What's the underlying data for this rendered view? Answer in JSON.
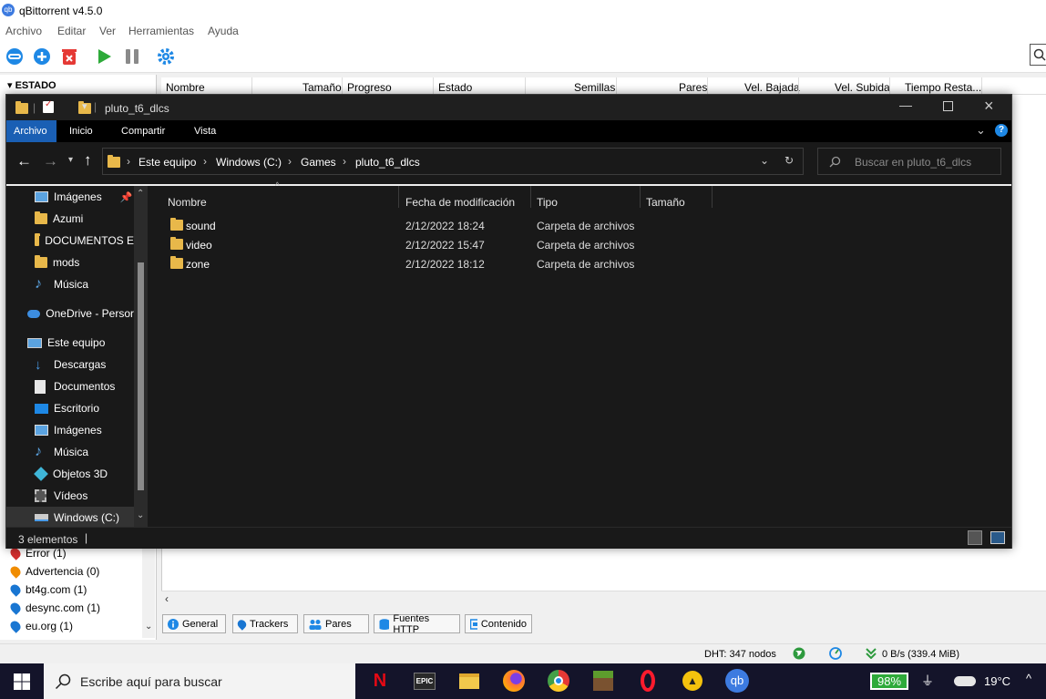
{
  "qbt": {
    "title": "qBittorrent v4.5.0",
    "icon_text": "qb",
    "menu": [
      "Archivo",
      "Editar",
      "Ver",
      "Herramientas",
      "Ayuda"
    ],
    "toolbar_icons": [
      "link-icon",
      "add-icon",
      "delete-icon",
      "play-icon",
      "pause-icon",
      "gear-icon"
    ],
    "estado_header": "ESTADO",
    "columns": [
      "Nombre",
      "Tamaño",
      "Progreso",
      "Estado",
      "Semillas",
      "Pares",
      "Vel. Bajada",
      "Vel. Subida",
      "Tiempo Resta..."
    ],
    "trackers": [
      {
        "label": "Error (1)",
        "color": "#d32f2f"
      },
      {
        "label": "Advertencia (0)",
        "color": "#f08c00"
      },
      {
        "label": "bt4g.com (1)",
        "color": "#1976d2"
      },
      {
        "label": "desync.com (1)",
        "color": "#1976d2"
      },
      {
        "label": "eu.org (1)",
        "color": "#1976d2"
      }
    ],
    "prop_tabs": [
      "General",
      "Trackers",
      "Pares",
      "Fuentes HTTP",
      "Contenido"
    ],
    "status": {
      "dht": "DHT: 347 nodos",
      "speed": "0 B/s (339.4 MiB)"
    }
  },
  "explorer": {
    "title": "pluto_t6_dlcs",
    "ribbon_tabs": [
      "Archivo",
      "Inicio",
      "Compartir",
      "Vista"
    ],
    "breadcrumb": [
      "Este equipo",
      "Windows (C:)",
      "Games",
      "pluto_t6_dlcs"
    ],
    "search_placeholder": "Buscar en pluto_t6_dlcs",
    "nav": [
      {
        "label": "Imágenes",
        "icon": "pictures-icon",
        "indent": 1
      },
      {
        "label": "Azumi",
        "icon": "folder-icon",
        "indent": 1
      },
      {
        "label": "DOCUMENTOS E",
        "icon": "folder-icon",
        "indent": 1
      },
      {
        "label": "mods",
        "icon": "folder-icon",
        "indent": 1
      },
      {
        "label": "Música",
        "icon": "music-icon",
        "indent": 1
      },
      {
        "label": "OneDrive - Persor",
        "icon": "cloud-icon",
        "indent": 0
      },
      {
        "label": "Este equipo",
        "icon": "computer-icon",
        "indent": 0
      },
      {
        "label": "Descargas",
        "icon": "download-icon",
        "indent": 1
      },
      {
        "label": "Documentos",
        "icon": "documents-icon",
        "indent": 1
      },
      {
        "label": "Escritorio",
        "icon": "desktop-icon",
        "indent": 1
      },
      {
        "label": "Imágenes",
        "icon": "pictures-icon",
        "indent": 1
      },
      {
        "label": "Música",
        "icon": "music-icon",
        "indent": 1
      },
      {
        "label": "Objetos 3D",
        "icon": "cube-icon",
        "indent": 1
      },
      {
        "label": "Vídeos",
        "icon": "video-icon",
        "indent": 1
      },
      {
        "label": "Windows (C:)",
        "icon": "drive-icon",
        "indent": 1
      }
    ],
    "columns": [
      "Nombre",
      "Fecha de modificación",
      "Tipo",
      "Tamaño"
    ],
    "files": [
      {
        "name": "sound",
        "date": "2/12/2022 18:24",
        "type": "Carpeta de archivos"
      },
      {
        "name": "video",
        "date": "2/12/2022 15:47",
        "type": "Carpeta de archivos"
      },
      {
        "name": "zone",
        "date": "2/12/2022 18:12",
        "type": "Carpeta de archivos"
      }
    ],
    "status_text": "3 elementos"
  },
  "taskbar": {
    "search_placeholder": "Escribe aquí para buscar",
    "apps": [
      {
        "name": "netflix-icon",
        "glyph": "N",
        "color": "#e50914",
        "bg": "#000"
      },
      {
        "name": "epic-games-icon",
        "glyph": "EPIC",
        "color": "#fff",
        "bg": "#2a2a2a"
      },
      {
        "name": "file-explorer-icon",
        "glyph": "",
        "color": "#f2c94c",
        "bg": "transparent"
      },
      {
        "name": "firefox-icon",
        "glyph": "",
        "color": "#ff7139",
        "bg": "transparent"
      },
      {
        "name": "chrome-icon",
        "glyph": "",
        "color": "#4caf50",
        "bg": "transparent"
      },
      {
        "name": "minecraft-icon",
        "glyph": "",
        "color": "#5d8c2d",
        "bg": "transparent"
      },
      {
        "name": "opera-icon",
        "glyph": "O",
        "color": "#ff1b2d",
        "bg": "transparent"
      },
      {
        "name": "warning-app-icon",
        "glyph": "▲",
        "color": "#222",
        "bg": "#f4c20d"
      },
      {
        "name": "qbittorrent-icon",
        "glyph": "qb",
        "color": "#fff",
        "bg": "#3d7be0"
      }
    ],
    "battery": "98%",
    "temperature": "19°C"
  }
}
